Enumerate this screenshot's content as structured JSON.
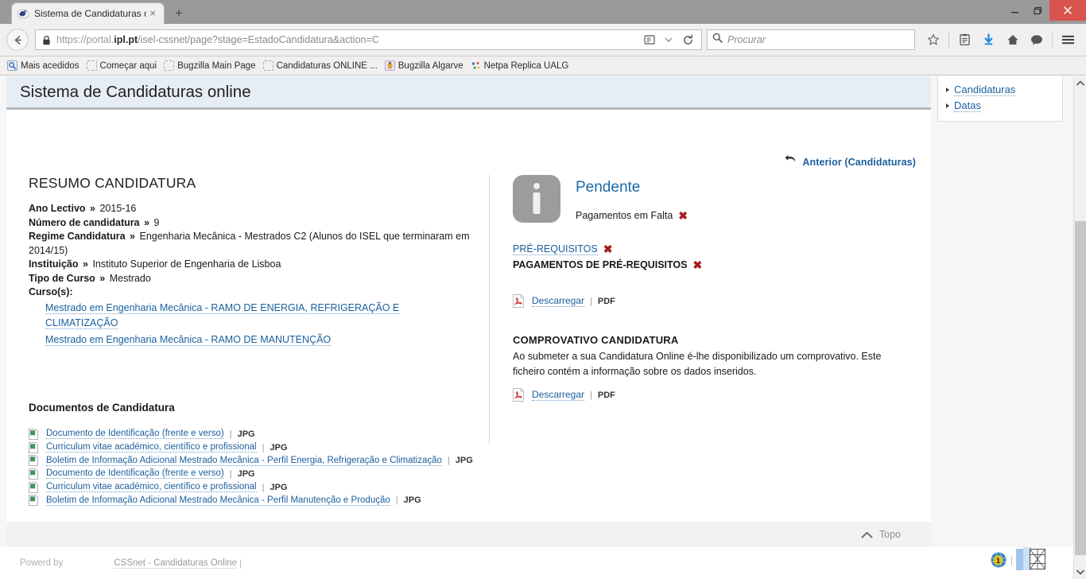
{
  "browser": {
    "tab": {
      "title": "Sistema de Candidaturas o...",
      "close_label": "×",
      "favicon": "globe-swirl-icon"
    },
    "new_tab_label": "+",
    "window_controls": {
      "minimize": "–",
      "maximize": "❐",
      "close": "✕"
    },
    "back_label": "←",
    "url": {
      "scheme": "https://portal.",
      "host_bold": "ipl.pt",
      "path": "/isel-cssnet/page?stage=EstadoCandidatura&action=C"
    },
    "search": {
      "placeholder": "Procurar"
    },
    "toolbar_icons": [
      "reader-icon",
      "dropdown-icon",
      "reload-icon",
      "bookmark-star-icon",
      "library-icon",
      "downloads-icon",
      "home-icon",
      "sync-chat-icon",
      "hamburger-menu-icon"
    ],
    "bookmarks": [
      {
        "label": "Mais acedidos",
        "icon": "most-visited-icon"
      },
      {
        "label": "Começar aqui",
        "icon": "generic-bookmark-icon"
      },
      {
        "label": "Bugzilla Main Page",
        "icon": "generic-bookmark-icon"
      },
      {
        "label": "Candidaturas ONLINE ...",
        "icon": "generic-bookmark-icon"
      },
      {
        "label": "Bugzilla Algarve",
        "icon": "bugzilla-favicon-icon"
      },
      {
        "label": "Netpa Replica UALG",
        "icon": "netpa-favicon-icon"
      }
    ]
  },
  "page": {
    "site_title": "Sistema de Candidaturas online",
    "back_link": {
      "label": "Anterior (Candidaturas)",
      "icon": "undo-arrow-icon"
    },
    "summary": {
      "heading": "RESUMO CANDIDATURA",
      "separator": "»",
      "fields": [
        {
          "label": "Ano Lectivo",
          "value": "2015-16"
        },
        {
          "label": "Número de candidatura",
          "value": "9"
        },
        {
          "label": "Regime Candidatura",
          "value": "Engenharia Mecânica - Mestrados C2 (Alunos do ISEL que terminaram em 2014/15)"
        },
        {
          "label": "Instituição",
          "value": "Instituto Superior de Engenharia de Lisboa"
        },
        {
          "label": "Tipo de Curso",
          "value": "Mestrado"
        }
      ],
      "courses_label": "Curso(s):",
      "courses": [
        "Mestrado em Engenharia Mecânica - RAMO DE ENERGIA, REFRIGERAÇÃO E CLIMATIZAÇÃO",
        "Mestrado em Engenharia Mecânica - RAMO DE MANUTENÇÃO"
      ]
    },
    "documents": {
      "heading": "Documentos de Candidatura",
      "items": [
        {
          "name": "Documento de Identificação (frente e verso)",
          "type": "JPG"
        },
        {
          "name": "Curriculum vitae académico, científico e profissional",
          "type": "JPG"
        },
        {
          "name": "Boletim de Informação Adicional Mestrado Mecânica - Perfil Energia, Refrigeração e Climatização",
          "type": "JPG"
        },
        {
          "name": "Documento de Identificação (frente e verso)",
          "type": "JPG"
        },
        {
          "name": "Curriculum vitae académico, científico e profissional",
          "type": "JPG"
        },
        {
          "name": "Boletim de Informação Adicional Mestrado Mecânica - Perfil Manutenção e Produção",
          "type": "JPG"
        }
      ],
      "separator": "|"
    },
    "status": {
      "icon": "info-icon",
      "title": "Pendente",
      "subtitle": "Pagamentos em Falta",
      "subtitle_mark": "✖",
      "requirements": [
        {
          "label": "PRÉ-REQUISITOS",
          "mark": "✖",
          "style": "link"
        },
        {
          "label": "PAGAMENTOS DE PRÉ-REQUISITOS",
          "mark": "✖",
          "style": "bold"
        }
      ],
      "download_top": {
        "link": "Descarregar",
        "separator": "|",
        "type": "PDF",
        "icon": "pdf-icon"
      }
    },
    "comprovativo": {
      "heading": "COMPROVATIVO CANDIDATURA",
      "text": "Ao submeter a sua Candidatura Online é-lhe disponibilizado um comprovativo. Este ficheiro contém a informação sobre os dados inseridos.",
      "download": {
        "link": "Descarregar",
        "separator": "|",
        "type": "PDF",
        "icon": "pdf-icon"
      }
    },
    "sidebar": {
      "items": [
        {
          "label": "Candidaturas"
        },
        {
          "label": "Datas"
        }
      ]
    },
    "topo": {
      "label": "Topo",
      "icon": "chevron-up-icon"
    },
    "footer": {
      "powered_label": "Powerd by",
      "product": "CSSnet - Candidaturas Online",
      "pipe": "|",
      "icons": [
        "globe-badge-icon",
        "broken-image-icon"
      ]
    }
  },
  "colors": {
    "link": "#1a5f9e",
    "status_title": "#1a6aa8",
    "error_mark": "#a81c1c",
    "header_bg": "#e7edf4",
    "info_badge": "#9c9c9c"
  }
}
